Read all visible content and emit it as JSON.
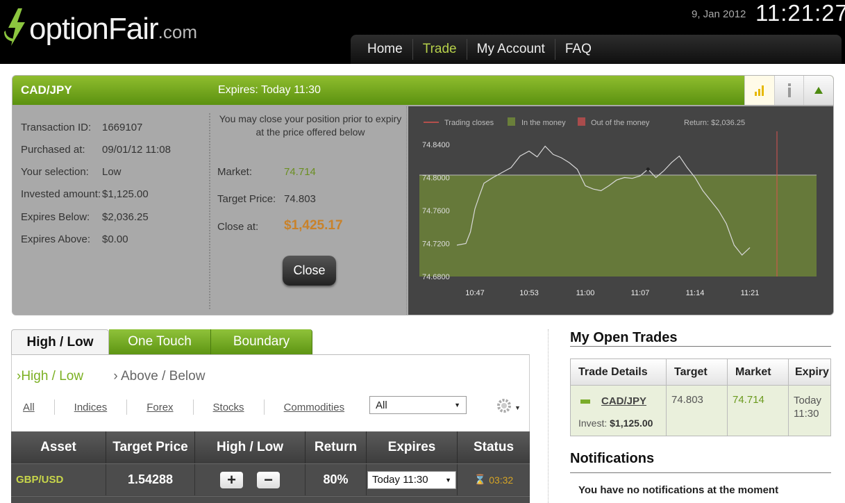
{
  "header": {
    "logo_text": "optionFair",
    "logo_tld": ".com",
    "date": "9, Jan 2012",
    "time": "11:21:27",
    "nav": [
      {
        "label": "Home",
        "active": false
      },
      {
        "label": "Trade",
        "active": true
      },
      {
        "label": "My Account",
        "active": false
      },
      {
        "label": "FAQ",
        "active": false
      }
    ]
  },
  "panel": {
    "asset": "CAD/JPY",
    "expires": "Expires:  Today 11:30",
    "tool_icons": [
      "bar-chart-icon",
      "info-icon",
      "collapse-up-icon"
    ],
    "details": [
      {
        "label": "Transaction ID:",
        "value": "1669107"
      },
      {
        "label": "Purchased at:",
        "value": "09/01/12 11:08"
      },
      {
        "label": "Your selection:",
        "value": "Low"
      },
      {
        "label": "Invested amount:",
        "value": "$1,125.00"
      },
      {
        "label": "Expires Below:",
        "value": "$2,036.25"
      },
      {
        "label": "Expires Above:",
        "value": "$0.00"
      }
    ],
    "close_note": "You may close your position prior to expiry at the price offered below",
    "market_label": "Market:",
    "market_value": "74.714",
    "target_label": "Target Price:",
    "target_value": "74.803",
    "closeat_label": "Close at:",
    "closeat_value": "$1,425.17",
    "close_button": "Close"
  },
  "chart_data": {
    "type": "line",
    "legend": [
      "Trading closes",
      "In the money",
      "Out of the money"
    ],
    "return_text": "Return: $2,036.25",
    "y_ticks": [
      "74.8400",
      "74.8000",
      "74.7600",
      "74.7200",
      "74.6800"
    ],
    "x_ticks": [
      "10:47",
      "10:53",
      "11:00",
      "11:07",
      "11:14",
      "11:21"
    ],
    "ylim": [
      74.68,
      74.84
    ],
    "target": 74.803,
    "colors": {
      "line": "#d8d8d8",
      "money": "#6a7f3a",
      "closes": "#d9534f"
    },
    "series": [
      {
        "x": [
          "10:45",
          "10:46",
          "10:46.5",
          "10:47",
          "10:47.5",
          "10:48",
          "10:49",
          "10:50",
          "10:51",
          "10:52",
          "10:53",
          "10:54",
          "10:55",
          "10:56",
          "10:57",
          "10:58",
          "10:59",
          "11:00",
          "11:01",
          "11:02",
          "11:03",
          "11:04",
          "11:05",
          "11:06",
          "11:07",
          "11:08",
          "11:09",
          "11:10",
          "11:11",
          "11:12",
          "11:13",
          "11:14",
          "11:15",
          "11:16",
          "11:17",
          "11:18",
          "11:19",
          "11:20",
          "11:21"
        ],
        "values": [
          74.718,
          74.72,
          74.734,
          74.762,
          74.778,
          74.793,
          74.8,
          74.806,
          74.812,
          74.826,
          74.832,
          74.825,
          74.838,
          74.828,
          74.824,
          74.818,
          74.81,
          74.79,
          74.786,
          74.784,
          74.79,
          74.797,
          74.8,
          74.799,
          74.802,
          74.81,
          74.8,
          74.808,
          74.818,
          74.826,
          74.812,
          74.8,
          74.784,
          74.772,
          74.76,
          74.744,
          74.718,
          74.706,
          74.715
        ]
      }
    ]
  },
  "tabs": [
    "High / Low",
    "One Touch",
    "Boundary"
  ],
  "subtabs": [
    "High / Low",
    "Above / Below"
  ],
  "filters": [
    "All",
    "Indices",
    "Forex",
    "Stocks",
    "Commodities"
  ],
  "filter_select": "All",
  "table": {
    "headers": [
      "Asset",
      "Target Price",
      "High / Low",
      "Return",
      "Expires",
      "Status"
    ],
    "row": {
      "asset": "GBP/USD",
      "target": "1.54288",
      "plus": "+",
      "minus": "−",
      "return": "80%",
      "expires": "Today 11:30",
      "status": "03:32"
    }
  },
  "open_trades": {
    "title": "My Open Trades",
    "headers": [
      "Trade Details",
      "Target",
      "Market",
      "Expiry"
    ],
    "row": {
      "asset": "CAD/JPY",
      "invest_label": "Invest:",
      "invest_value": "$1,125.00",
      "target": "74.803",
      "market": "74.714",
      "expiry": "Today 11:30"
    }
  },
  "notifications": {
    "title": "Notifications",
    "message": "You have no notifications at the moment"
  }
}
